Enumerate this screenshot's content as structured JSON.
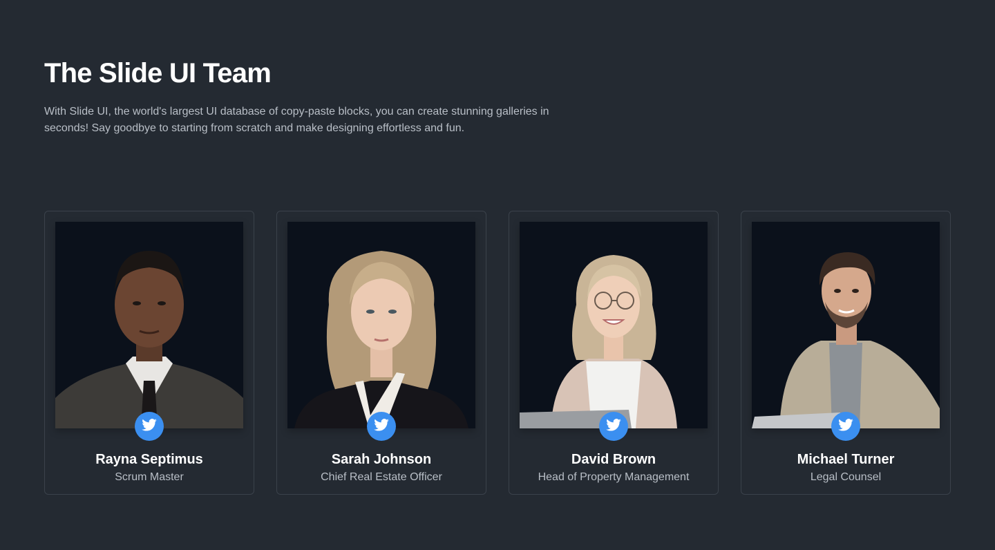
{
  "header": {
    "title": "The Slide UI Team",
    "description": "With Slide UI, the world's largest UI database of copy-paste blocks, you can create stunning galleries in seconds! Say goodbye to starting from scratch and make designing effortless and fun."
  },
  "members": [
    {
      "name": "Rayna Septimus",
      "role": "Scrum Master",
      "social_icon": "twitter-icon"
    },
    {
      "name": "Sarah Johnson",
      "role": "Chief Real Estate Officer",
      "social_icon": "twitter-icon"
    },
    {
      "name": "David Brown",
      "role": "Head of Property Management",
      "social_icon": "twitter-icon"
    },
    {
      "name": "Michael Turner",
      "role": "Legal Counsel",
      "social_icon": "twitter-icon"
    }
  ],
  "colors": {
    "background": "#242a32",
    "photo_background": "#0b111b",
    "accent": "#3b8ff0",
    "card_border": "#3b424b"
  }
}
